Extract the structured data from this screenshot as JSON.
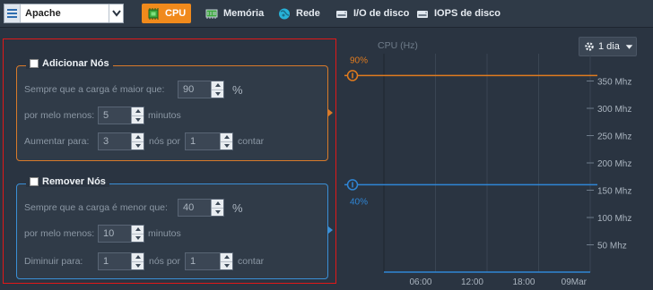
{
  "toolbar": {
    "app_select": {
      "value": "Apache",
      "icon": "list-icon"
    },
    "tabs": [
      {
        "label": "CPU",
        "icon": "cpu-icon",
        "active": true
      },
      {
        "label": "Memória",
        "icon": "memory-icon",
        "active": false
      },
      {
        "label": "Rede",
        "icon": "network-icon",
        "active": false
      },
      {
        "label": "I/O de disco",
        "icon": "disk-icon",
        "active": false
      },
      {
        "label": "IOPS de disco",
        "icon": "disk-icon",
        "active": false
      }
    ]
  },
  "add_nodes": {
    "title": "Adicionar Nós",
    "load_label": "Sempre que a carga é maior que:",
    "load_value": "90",
    "load_unit": "%",
    "duration_label": "por melo menos:",
    "duration_value": "5",
    "duration_unit": "minutos",
    "increase_label": "Aumentar para:",
    "increase_value": "3",
    "nodes_per": "nós por",
    "count_value": "1",
    "count_unit": "contar"
  },
  "remove_nodes": {
    "title": "Remover Nós",
    "load_label": "Sempre que a carga é menor que:",
    "load_value": "40",
    "load_unit": "%",
    "duration_label": "por melo menos:",
    "duration_value": "10",
    "duration_unit": "minutos",
    "decrease_label": "Diminuir para:",
    "decrease_value": "1",
    "nodes_per": "nós por",
    "count_value": "1",
    "count_unit": "contar"
  },
  "chart": {
    "title": "CPU (Hz)",
    "period": "1 dia",
    "upper_threshold_label": "90%",
    "lower_threshold_label": "40%",
    "colors": {
      "upper": "#e07b1e",
      "lower": "#2f86d6",
      "grid": "#3a4553",
      "axis_text": "#aab4bf"
    }
  },
  "chart_data": {
    "type": "line",
    "y_ticks": [
      "350 Mhz",
      "300 Mhz",
      "250 Mhz",
      "200 Mhz",
      "150 Mhz",
      "100 Mhz",
      "50 Mhz"
    ],
    "y_values": [
      350,
      300,
      250,
      200,
      150,
      100,
      50
    ],
    "x_ticks": [
      "06:00",
      "12:00",
      "18:00",
      "09Mar"
    ],
    "thresholds": [
      {
        "label": "90%",
        "value": 360,
        "color": "#e07b1e"
      },
      {
        "label": "40%",
        "value": 160,
        "color": "#2f86d6"
      }
    ],
    "series": [
      {
        "values": [
          0,
          0,
          0,
          0,
          0
        ],
        "color": "#2f86d6"
      }
    ],
    "ylim": [
      0,
      400
    ]
  }
}
